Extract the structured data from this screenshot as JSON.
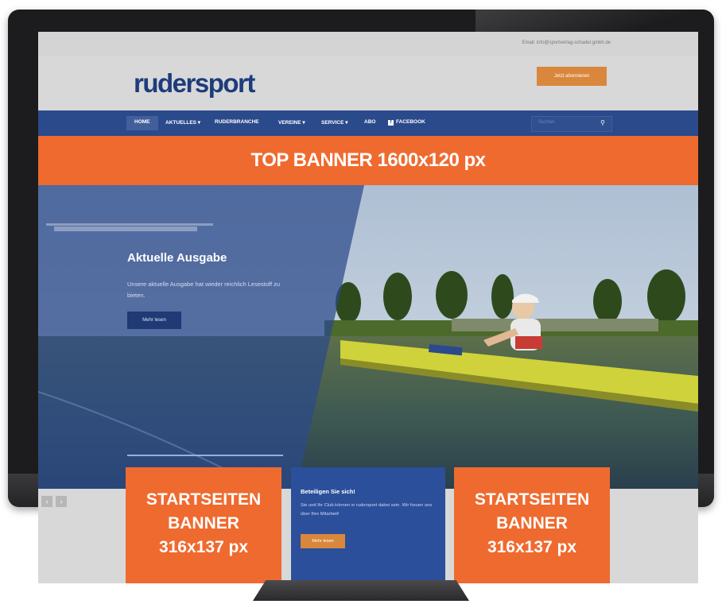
{
  "site": {
    "topbar_email": "Email: info@sportverlag-schadel.gmbh.de",
    "logo": "rudersport",
    "abo_button": "Jetzt abonnieren"
  },
  "nav": {
    "items": [
      "HOME",
      "AKTUELLES ▾",
      "RUDERBRANCHE",
      "VEREINE ▾",
      "SERVICE ▾",
      "ABO",
      "FACEBOOK"
    ],
    "search_placeholder": "Suchen",
    "search_icon": "search-icon"
  },
  "top_banner": {
    "label": "TOP BANNER 1600x120 px"
  },
  "hero": {
    "title": "Aktuelle Ausgabe",
    "text": "Unsere aktuelle Ausgabe hat wieder reichlich Lesestoff zu bieten.",
    "button": "Mehr lesen"
  },
  "pager": {
    "prev": "‹",
    "next": "›"
  },
  "startseiten_banner_left": {
    "line1": "STARTSEITEN",
    "line2": "BANNER",
    "line3": "316x137 px"
  },
  "startseiten_banner_right": {
    "line1": "STARTSEITEN",
    "line2": "BANNER",
    "line3": "316x137 px"
  },
  "promo": {
    "title": "Beteiligen Sie sich!",
    "text": "Sie und Ihr Club können in rudersport dabei sein. Wir freuen uns über Ihre Mitarbeit!",
    "button": "Mehr lesen"
  },
  "colors": {
    "brand_blue": "#2b4a8b",
    "banner_orange": "#ef6a2f",
    "button_orange": "#d9873c",
    "logo_blue": "#1e3c7c"
  }
}
